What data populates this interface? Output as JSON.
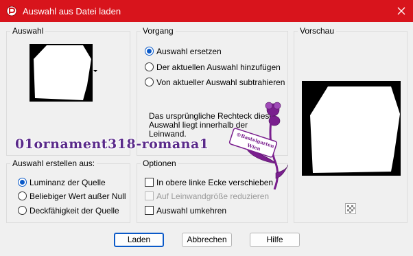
{
  "window": {
    "title": "Auswahl aus Datei laden"
  },
  "auswahl_group": {
    "label": "Auswahl"
  },
  "vorgang_group": {
    "label": "Vorgang",
    "options": [
      {
        "label": "Auswahl ersetzen",
        "checked": true
      },
      {
        "label": "Der aktuellen Auswahl hinzufügen",
        "checked": false
      },
      {
        "label": "Von aktueller Auswahl subtrahieren",
        "checked": false
      }
    ],
    "info_lines": [
      "Das ursprüngliche Rechteck dieser",
      "Auswahl liegt innerhalb der",
      "Leinwand."
    ]
  },
  "vorschau_group": {
    "label": "Vorschau"
  },
  "erstellen_group": {
    "label": "Auswahl erstellen aus:",
    "options": [
      {
        "label": "Luminanz der Quelle",
        "checked": true
      },
      {
        "label": "Beliebiger Wert außer Null",
        "checked": false
      },
      {
        "label": "Deckfähigkeit der Quelle",
        "checked": false
      }
    ]
  },
  "optionen_group": {
    "label": "Optionen",
    "options": [
      {
        "label": "In obere linke Ecke verschieben",
        "checked": false,
        "disabled": false
      },
      {
        "label": "Auf Leinwandgröße reduzieren",
        "checked": false,
        "disabled": true
      },
      {
        "label": "Auswahl umkehren",
        "checked": false,
        "disabled": false
      }
    ]
  },
  "buttons": {
    "load": "Laden",
    "cancel": "Abbrechen",
    "help": "Hilfe"
  },
  "watermark": {
    "text": "01ornament318-romana1",
    "stamp_line1": "©Bastelgarten",
    "stamp_line2": "Wien"
  },
  "colors": {
    "titlebar": "#d8141c",
    "accent": "#0a59c8",
    "watermark": "#7a1f8e"
  }
}
